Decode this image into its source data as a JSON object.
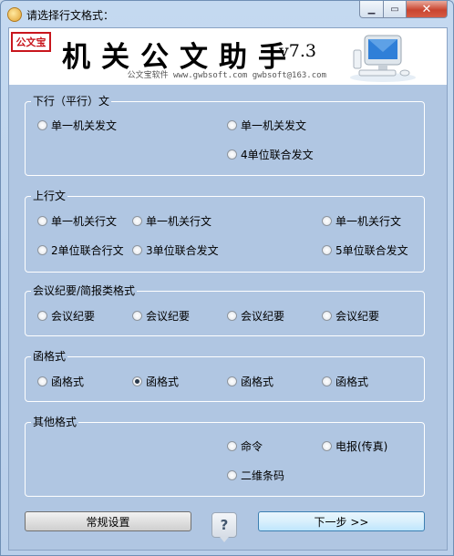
{
  "window": {
    "title": "请选择行文格式："
  },
  "banner": {
    "seal_text": "公文宝",
    "title": "机关公文助手",
    "version": "v7.3",
    "subtitle": "公文宝软件 www.gwbsoft.com gwbsoft@163.com"
  },
  "groups": {
    "downward": {
      "label": "下行（平行）文",
      "options": [
        "单一机关发文",
        "单一机关发文",
        "4单位联合发文"
      ]
    },
    "upward": {
      "label": "上行文",
      "options": [
        "单一机关行文",
        "单一机关行文",
        "单一机关行文",
        "2单位联合行文",
        "3单位联合发文",
        "5单位联合发文"
      ]
    },
    "minutes": {
      "label": "会议纪要/简报类格式",
      "options": [
        "会议纪要",
        "会议纪要",
        "会议纪要",
        "会议纪要"
      ]
    },
    "letter": {
      "label": "函格式",
      "options": [
        "函格式",
        "函格式",
        "函格式",
        "函格式"
      ],
      "selected_index": 1
    },
    "other": {
      "label": "其他格式",
      "options": [
        "命令",
        "电报(传真)",
        "二维条码"
      ]
    }
  },
  "buttons": {
    "settings": "常规设置",
    "help": "?",
    "next": "下一步 >>"
  },
  "icons": {
    "app": "app-icon",
    "minimize": "minimize-icon",
    "maximize": "maximize-icon",
    "close": "close-icon",
    "help": "question-icon"
  }
}
